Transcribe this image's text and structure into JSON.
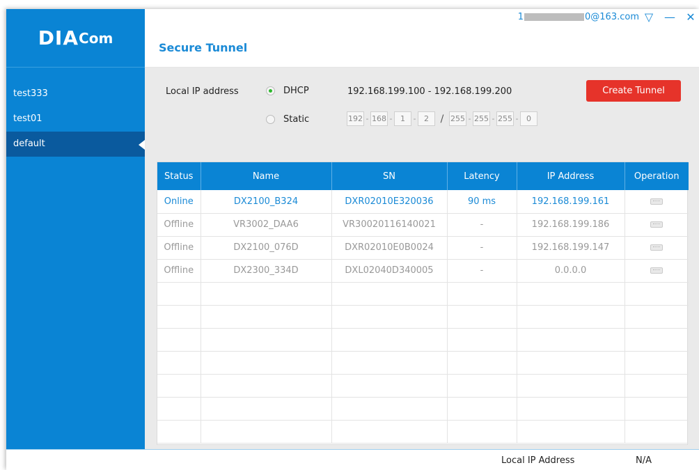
{
  "app": {
    "logo_main": "DIA",
    "logo_sub": "Com"
  },
  "sidebar": {
    "items": [
      {
        "label": "test333"
      },
      {
        "label": "test01"
      },
      {
        "label": "default"
      }
    ],
    "active_index": 2
  },
  "header": {
    "title": "Secure Tunnel",
    "account_prefix": "1",
    "account_suffix": "0@163.com",
    "controls": {
      "dropdown_icon": "▽",
      "minimize_icon": "—",
      "close_icon": "✕"
    }
  },
  "network": {
    "local_ip_label": "Local IP address",
    "dhcp_label": "DHCP",
    "static_label": "Static",
    "selected_mode": "DHCP",
    "dhcp_range": "192.168.199.100 - 192.168.199.200",
    "create_button": "Create Tunnel",
    "static_ip": [
      "192",
      "168",
      "1",
      "2"
    ],
    "static_mask": [
      "255",
      "255",
      "255",
      "0"
    ]
  },
  "table": {
    "columns": [
      "Status",
      "Name",
      "SN",
      "Latency",
      "IP Address",
      "Operation"
    ],
    "rows": [
      {
        "status": "Online",
        "name": "DX2100_B324",
        "sn": "DXR02010E320036",
        "latency": "90 ms",
        "ip": "192.168.199.161"
      },
      {
        "status": "Offline",
        "name": "VR3002_DAA6",
        "sn": "VR30020116140021",
        "latency": "-",
        "ip": "192.168.199.186"
      },
      {
        "status": "Offline",
        "name": "DX2100_076D",
        "sn": "DXR02010E0B0024",
        "latency": "-",
        "ip": "192.168.199.147"
      },
      {
        "status": "Offline",
        "name": "DX2300_334D",
        "sn": "DXL02040D340005",
        "latency": "-",
        "ip": "0.0.0.0"
      }
    ],
    "empty_rows": 7
  },
  "footer": {
    "label": "Local IP Address",
    "value": "N/A"
  },
  "colors": {
    "accent": "#0a84d4",
    "active_item": "#0a5a9e",
    "create_button": "#e6332a",
    "online_text": "#1a8ad6",
    "radio_on": "#2eb82e"
  }
}
